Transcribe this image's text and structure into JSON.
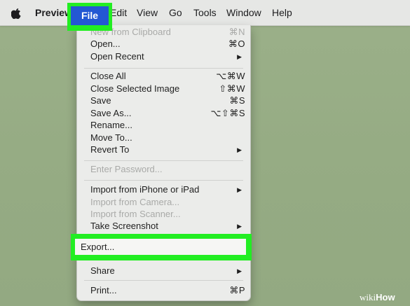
{
  "menubar": {
    "apple_icon": "apple-logo-icon",
    "app_name": "Preview",
    "items": [
      "File",
      "Edit",
      "Go",
      "View",
      "Tools",
      "Window",
      "Help"
    ],
    "file": "File",
    "edit": "Edit",
    "view": "View",
    "go": "Go",
    "tools": "Tools",
    "window": "Window",
    "help": "Help",
    "selected_menu_color": "#2358d3"
  },
  "file_menu": {
    "new_from_clipboard": {
      "label": "New from Clipboard",
      "shortcut": "⌘N",
      "enabled": false
    },
    "open": {
      "label": "Open...",
      "shortcut": "⌘O"
    },
    "open_recent": {
      "label": "Open Recent",
      "submenu_icon": "triangle-right-icon"
    },
    "close_all": {
      "label": "Close All",
      "shortcut": "⌥⌘W"
    },
    "close_selected": {
      "label": "Close Selected Image",
      "shortcut": "⇧⌘W"
    },
    "save": {
      "label": "Save",
      "shortcut": "⌘S"
    },
    "save_as": {
      "label": "Save As...",
      "shortcut": "⌥⇧⌘S"
    },
    "rename": {
      "label": "Rename..."
    },
    "move_to": {
      "label": "Move To..."
    },
    "revert_to": {
      "label": "Revert To",
      "submenu_icon": "triangle-right-icon"
    },
    "enter_password": {
      "label": "Enter Password...",
      "enabled": false
    },
    "import_iphone": {
      "label": "Import from iPhone or iPad",
      "submenu_icon": "triangle-right-icon"
    },
    "import_camera": {
      "label": "Import from Camera...",
      "enabled": false
    },
    "import_scanner": {
      "label": "Import from Scanner...",
      "enabled": false
    },
    "take_screenshot": {
      "label": "Take Screenshot",
      "submenu_icon": "triangle-right-icon"
    },
    "export": {
      "label": "Export..."
    },
    "share": {
      "label": "Share",
      "submenu_icon": "triangle-right-icon"
    },
    "print": {
      "label": "Print...",
      "shortcut": "⌘P"
    }
  },
  "highlight_color": "#22ee22",
  "watermark": {
    "part1": "wiki",
    "part2": "How"
  }
}
